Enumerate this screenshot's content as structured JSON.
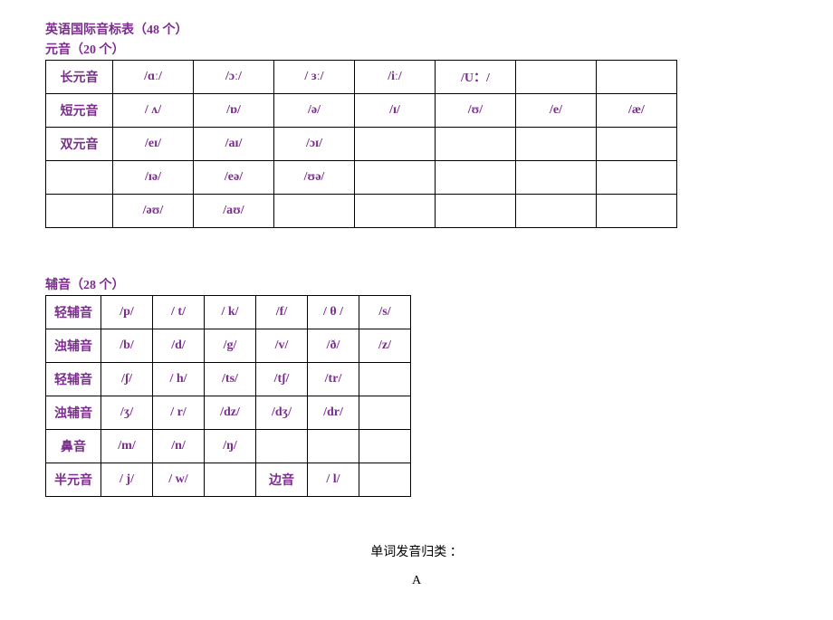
{
  "chart_data": {
    "type": "table",
    "title": "英语国际音标表（48 个）",
    "sections": [
      {
        "name": "元音（20 个）",
        "rows": [
          {
            "label": "长元音",
            "cells": [
              "/ɑː/",
              "/ɔː/",
              "/ ɜː/",
              "/iː/",
              "/U：/",
              "",
              ""
            ]
          },
          {
            "label": "短元音",
            "cells": [
              "/ ʌ/",
              "/ɒ/",
              "/ə/",
              "/ɪ/",
              "/ʊ/",
              "/e/",
              "/æ/"
            ]
          },
          {
            "label": "双元音",
            "cells": [
              "/eɪ/",
              "/aɪ/",
              "/ɔɪ/",
              "",
              "",
              "",
              ""
            ]
          },
          {
            "label": "",
            "cells": [
              "/ɪə/",
              "/eə/",
              "/ʊə/",
              "",
              "",
              "",
              ""
            ]
          },
          {
            "label": "",
            "cells": [
              "/əʊ/",
              "/aʊ/",
              "",
              "",
              "",
              "",
              ""
            ]
          }
        ]
      },
      {
        "name": "辅音（28 个）",
        "rows": [
          {
            "label": "轻辅音",
            "cells": [
              "/p/",
              "/ t/",
              "/ k/",
              "/f/",
              "/ θ /",
              "/s/"
            ]
          },
          {
            "label": "浊辅音",
            "cells": [
              "/b/",
              "/d/",
              "/g/",
              "/v/",
              "/ð/",
              "/z/"
            ]
          },
          {
            "label": "轻辅音",
            "cells": [
              "/ʃ/",
              "/ h/",
              "/ts/",
              "/tʃ/",
              "/tr/",
              ""
            ]
          },
          {
            "label": "浊辅音",
            "cells": [
              "/ʒ/",
              "/ r/",
              "/dz/",
              "/dʒ/",
              "/dr/",
              ""
            ]
          },
          {
            "label": "鼻音",
            "cells": [
              "/m/",
              "/n/",
              "/ŋ/",
              "",
              "",
              ""
            ]
          },
          {
            "label": "半元音",
            "cells": [
              "/ j/",
              "/ w/",
              "",
              "边音",
              "/ l/",
              ""
            ]
          }
        ]
      }
    ]
  },
  "footer": {
    "line1": "单词发音归类 ：",
    "line2": "A"
  }
}
